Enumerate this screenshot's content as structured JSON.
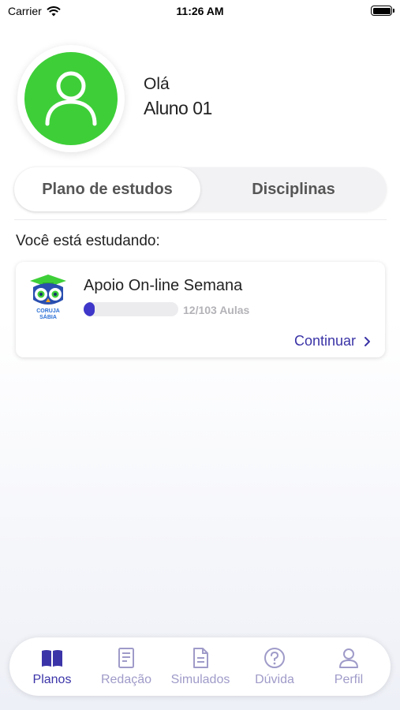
{
  "status_bar": {
    "carrier": "Carrier",
    "time": "11:26 AM"
  },
  "profile": {
    "greeting": "Olá",
    "name": "Aluno 01",
    "avatar_color": "#3ecf38"
  },
  "segmented": {
    "tabs": [
      {
        "label": "Plano de estudos",
        "active": true
      },
      {
        "label": "Disciplinas",
        "active": false
      }
    ]
  },
  "section": {
    "label": "Você está estudando:"
  },
  "course": {
    "logo_line1": "CORUJA",
    "logo_line2": "SÁBIA",
    "title": "Apoio On-line Semana",
    "progress_text": "12/103 Aulas",
    "progress": 0.1165,
    "continue_label": "Continuar"
  },
  "tabbar": {
    "accent": "#3b34a8",
    "inactive_color": "#9f9bc9",
    "items": [
      {
        "label": "Planos",
        "icon": "book-icon",
        "active": true
      },
      {
        "label": "Redação",
        "icon": "essay-icon",
        "active": false
      },
      {
        "label": "Simulados",
        "icon": "document-icon",
        "active": false
      },
      {
        "label": "Dúvida",
        "icon": "question-icon",
        "active": false
      },
      {
        "label": "Perfil",
        "icon": "person-icon",
        "active": false
      }
    ]
  }
}
